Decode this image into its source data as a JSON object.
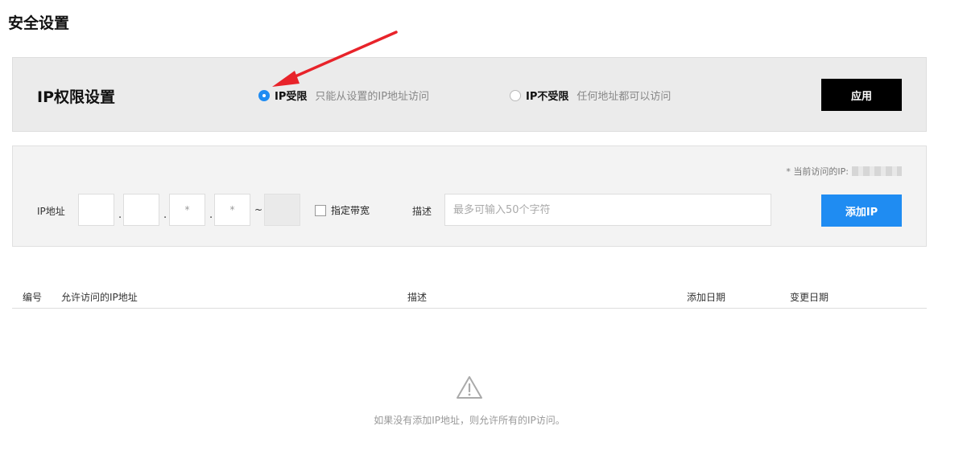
{
  "page": {
    "title": "安全设置"
  },
  "permission": {
    "title": "IP权限设置",
    "options": [
      {
        "label": "IP受限",
        "desc": "只能从设置的IP地址访问",
        "checked": true
      },
      {
        "label": "IP不受限",
        "desc": "任何地址都可以访问",
        "checked": false
      }
    ],
    "apply_label": "应用"
  },
  "add_ip": {
    "current_ip_label": "* 当前访问的IP:",
    "ip_label": "IP地址",
    "octets": [
      "",
      "",
      "*",
      "*"
    ],
    "tilde": "~",
    "bandwidth_label": "指定带宽",
    "desc_label": "描述",
    "desc_placeholder": "最多可输入50个字符",
    "add_label": "添加IP"
  },
  "table": {
    "columns": [
      "编号",
      "允许访问的IP地址",
      "描述",
      "添加日期",
      "变更日期"
    ],
    "empty_text": "如果没有添加IP地址，则允许所有的IP访问。"
  },
  "colors": {
    "accent": "#1f8cf2",
    "annotation_arrow": "#e8232a"
  },
  "icons": {
    "empty": "warning-triangle-icon",
    "annotation": "red-arrow-icon"
  }
}
